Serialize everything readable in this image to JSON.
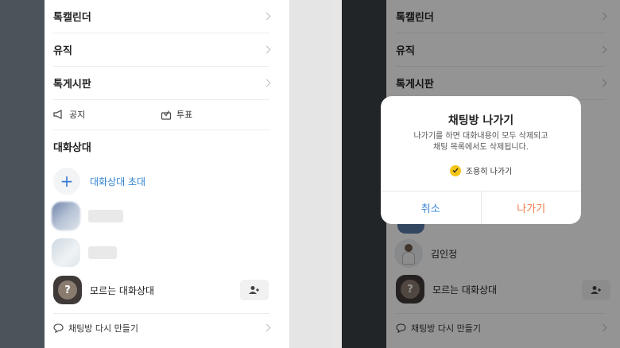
{
  "left": {
    "menu": [
      {
        "label": "톡캘린더"
      },
      {
        "label": "유직"
      },
      {
        "label": "톡게시판"
      }
    ],
    "notice_label": "공지",
    "vote_label": "투표",
    "section_title": "대화상대",
    "invite_label": "대화상대 초대",
    "unknown_member_label": "모르는 대화상대",
    "recreate_label": "채팅방 다시 만들기"
  },
  "right": {
    "menu": [
      {
        "label": "톡캘린더"
      },
      {
        "label": "유직"
      },
      {
        "label": "톡게시판"
      }
    ],
    "member_name": "김인정",
    "unknown_member_label": "모르는 대화상대",
    "recreate_label": "채팅방 다시 만들기",
    "dialog": {
      "title": "채팅방 나가기",
      "message_line1": "나가기를 하면 대화내용이 모두 삭제되고",
      "message_line2": "채팅 목록에서도 삭제됩니다.",
      "checkbox_label": "조용히 나가기",
      "checkbox_checked": true,
      "cancel_label": "취소",
      "leave_label": "나가기"
    }
  },
  "colors": {
    "accent_blue": "#2f80d0",
    "leave_orange": "#f07a4a",
    "check_yellow": "#f5c518"
  }
}
